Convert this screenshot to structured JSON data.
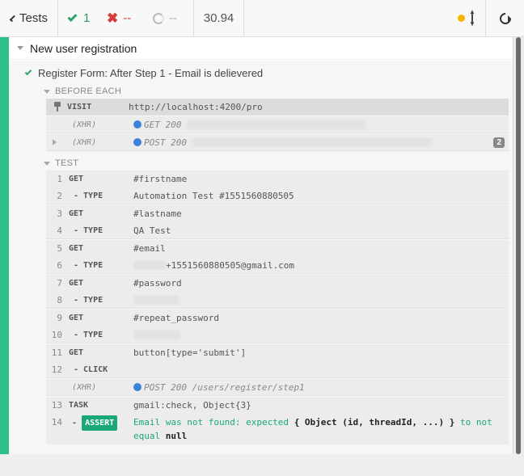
{
  "header": {
    "tests_label": "Tests",
    "passed_count": "1",
    "failed_count": "--",
    "pending_count": "--",
    "duration": "30.94"
  },
  "suite": {
    "title": "New user registration"
  },
  "test": {
    "title": "Register Form: After Step 1 - Email is delievered"
  },
  "before_each": {
    "label": "BEFORE EACH",
    "commands": [
      {
        "name": "VISIT",
        "message": "http://localhost:4200/pro"
      },
      {
        "name": "(XHR)",
        "method": "GET 200"
      },
      {
        "name": "(XHR)",
        "method": "POST 200",
        "badge": "2"
      }
    ]
  },
  "test_section": {
    "label": "TEST",
    "commands": [
      {
        "num": "1",
        "name": "GET",
        "message": "#firstname"
      },
      {
        "num": "2",
        "name": "- TYPE",
        "message": "Automation Test #1551560880505"
      },
      {
        "num": "3",
        "name": "GET",
        "message": "#lastname"
      },
      {
        "num": "4",
        "name": "- TYPE",
        "message": "QA Test"
      },
      {
        "num": "5",
        "name": "GET",
        "message": "#email"
      },
      {
        "num": "6",
        "name": "- TYPE",
        "message": "+1551560880505@gmail.com"
      },
      {
        "num": "7",
        "name": "GET",
        "message": "#password"
      },
      {
        "num": "8",
        "name": "- TYPE",
        "message": ""
      },
      {
        "num": "9",
        "name": "GET",
        "message": "#repeat_password"
      },
      {
        "num": "10",
        "name": "- TYPE",
        "message": ""
      },
      {
        "num": "11",
        "name": "GET",
        "message": "button[type='submit']"
      },
      {
        "num": "12",
        "name": "- CLICK",
        "message": ""
      },
      {
        "num": "",
        "name": "(XHR)",
        "message": "POST 200 /users/register/step1"
      },
      {
        "num": "13",
        "name": "TASK",
        "message": "gmail:check, Object{3}"
      },
      {
        "num": "14",
        "name": "ASSERT",
        "prefix": "-"
      }
    ],
    "assert_message": {
      "part1": "Email was not found: expected ",
      "obj": "{ Object (id, threadId, ...) }",
      "part2": " to not equal ",
      "value": "null"
    }
  }
}
